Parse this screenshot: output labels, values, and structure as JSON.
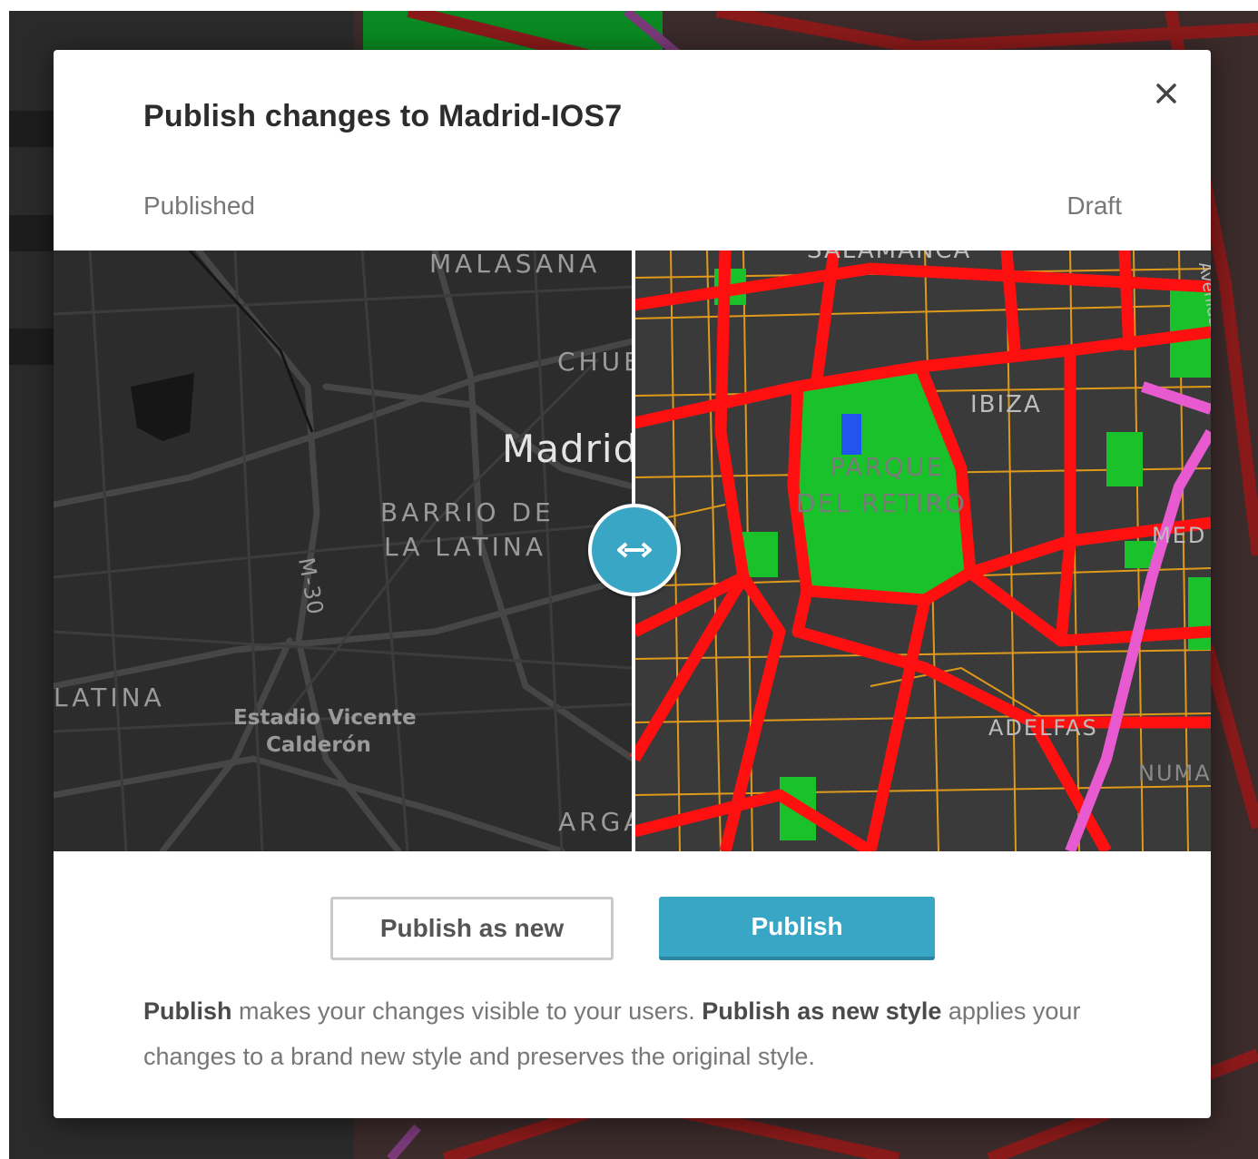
{
  "modal": {
    "title": "Publish changes to Madrid-IOS7",
    "close_icon": "close-icon",
    "left_label": "Published",
    "right_label": "Draft"
  },
  "compare": {
    "handle_icon": "horizontal-arrows-icon",
    "published_map_labels": {
      "malasana": "MALASANA",
      "chueca": "CHUECA",
      "madrid": "Madrid",
      "barrio_line1": "BARRIO DE",
      "barrio_line2": "LA LATINA",
      "m30": "M-30",
      "latina": "LATINA",
      "estadio_line1": "Estadio Vicente",
      "estadio_line2": "Calderón",
      "arganzuela": "ARGANZUELA"
    },
    "draft_map_labels": {
      "salamanca": "SALAMANCA",
      "ibiza": "IBIZA",
      "parque_line1": "PARQUE",
      "parque_line2": "DEL RETIRO",
      "medio": "MED",
      "adelfas": "ADELFAS",
      "numancia": "NUMA",
      "avenida": "Avenida"
    },
    "colors": {
      "published_bg": "#2c2c2c",
      "draft_bg": "#3a3a3a",
      "draft_road": "#ff1010",
      "draft_park": "#19c22b",
      "draft_minor": "#e09a1a",
      "draft_rail": "#e85ad0",
      "accent": "#3aa6c6"
    }
  },
  "actions": {
    "publish_new_label": "Publish as new",
    "publish_label": "Publish"
  },
  "help": {
    "bold1": "Publish",
    "text1": " makes your changes visible to your users. ",
    "bold2": "Publish as new style",
    "text2": " applies your changes to a brand new style and preserves the original style."
  }
}
